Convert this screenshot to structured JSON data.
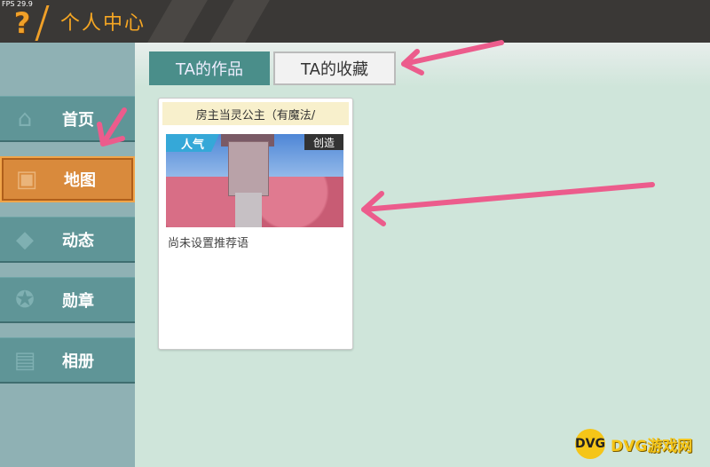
{
  "fps": "FPS 29.9",
  "header": {
    "help_icon": "?",
    "title": "个人中心"
  },
  "sidebar": {
    "items": [
      {
        "label": "首页",
        "icon": "home-icon",
        "active": false
      },
      {
        "label": "地图",
        "icon": "map-icon",
        "active": true
      },
      {
        "label": "动态",
        "icon": "bell-icon",
        "active": false
      },
      {
        "label": "勋章",
        "icon": "medal-icon",
        "active": false
      },
      {
        "label": "相册",
        "icon": "album-icon",
        "active": false
      }
    ]
  },
  "tabs": [
    {
      "label": "TA的作品",
      "active": false
    },
    {
      "label": "TA的收藏",
      "active": true
    }
  ],
  "card": {
    "title": "房主当灵公主（有魔法/",
    "badge_popular": "人气",
    "badge_create": "创造",
    "description": "尚未设置推荐语"
  },
  "watermark": {
    "logo_text": "DVG",
    "text": "DVG游戏网"
  },
  "colors": {
    "accent": "#f5a623",
    "active_tab": "#d98a3c",
    "arrow": "#ec5c8c"
  }
}
